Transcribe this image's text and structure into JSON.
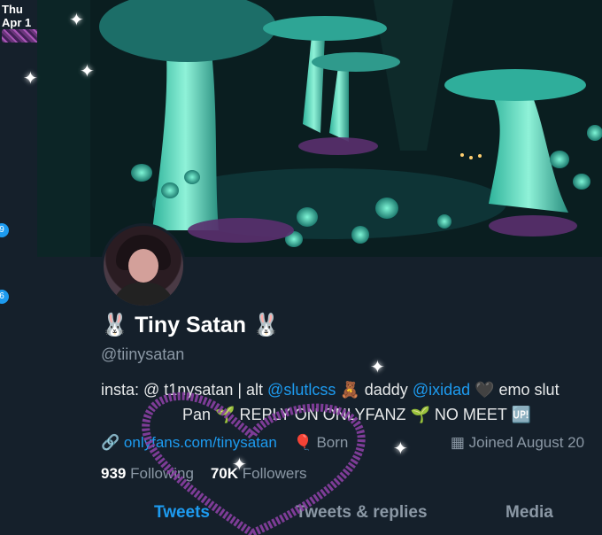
{
  "status": {
    "date": "Thu Apr 1"
  },
  "sidebar": {
    "badges": [
      "9",
      "6"
    ]
  },
  "profile": {
    "name": "Tiny Satan",
    "name_emoji": "🐰",
    "handle": "@tiinysatan",
    "bio_line1": {
      "prefix": "insta: @ t1nysatan | alt ",
      "alt_handle": "@slutlcss",
      "middle": " 🧸 daddy ",
      "daddy_handle": "@ixidad",
      "suffix": " 🖤 emo slut"
    },
    "bio_line2": "Pan 🌱 REPLY ON ONLYFANZ 🌱 NO MEET 🆙",
    "link": "onlyfans.com/tinysatan",
    "born": "Born",
    "joined": "Joined August 20",
    "following_count": "939",
    "following_label": "Following",
    "followers_count": "70K",
    "followers_label": "Followers"
  },
  "tabs": [
    "Tweets",
    "Tweets & replies",
    "Media"
  ],
  "icons": {
    "link": "link-icon",
    "born": "balloon-icon",
    "joined": "calendar-icon"
  },
  "colors": {
    "background": "#15202b",
    "accent": "#1d9bf0",
    "muted": "#8b98a5",
    "glitter": "#9b4fb0"
  }
}
